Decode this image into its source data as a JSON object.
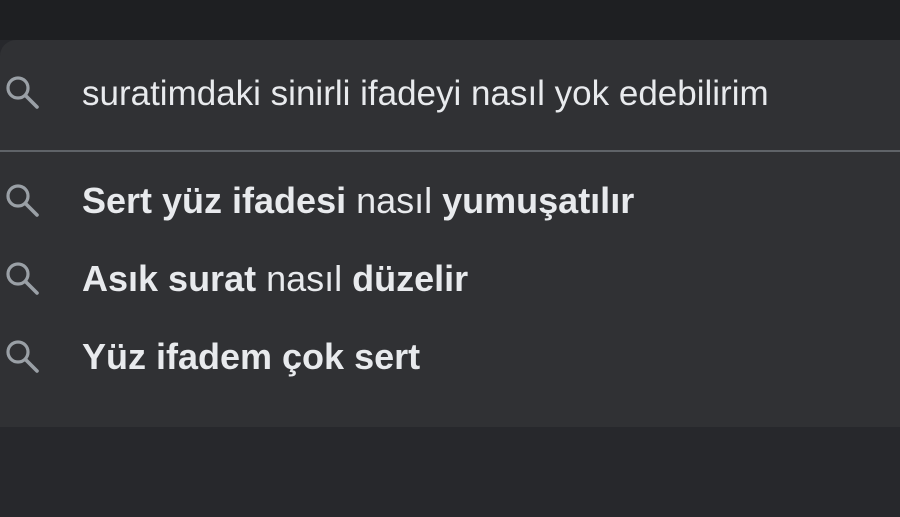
{
  "search": {
    "query": "suratimdaki sinirli ifadeyi nasıl yok edebilirim",
    "icon": "search-icon"
  },
  "suggestions": [
    {
      "parts": [
        {
          "text": "Sert yüz ifadesi",
          "bold": true
        },
        {
          "text": " nasıl ",
          "bold": false
        },
        {
          "text": "yumuşatılır",
          "bold": true
        }
      ]
    },
    {
      "parts": [
        {
          "text": "Asık surat",
          "bold": true
        },
        {
          "text": " nasıl ",
          "bold": false
        },
        {
          "text": "düzelir",
          "bold": true
        }
      ]
    },
    {
      "parts": [
        {
          "text": "Yüz ifadem çok sert",
          "bold": true
        }
      ]
    }
  ],
  "colors": {
    "panel": "#303134",
    "text": "#e8eaed",
    "icon": "#9aa0a6",
    "divider": "#5f6368"
  }
}
